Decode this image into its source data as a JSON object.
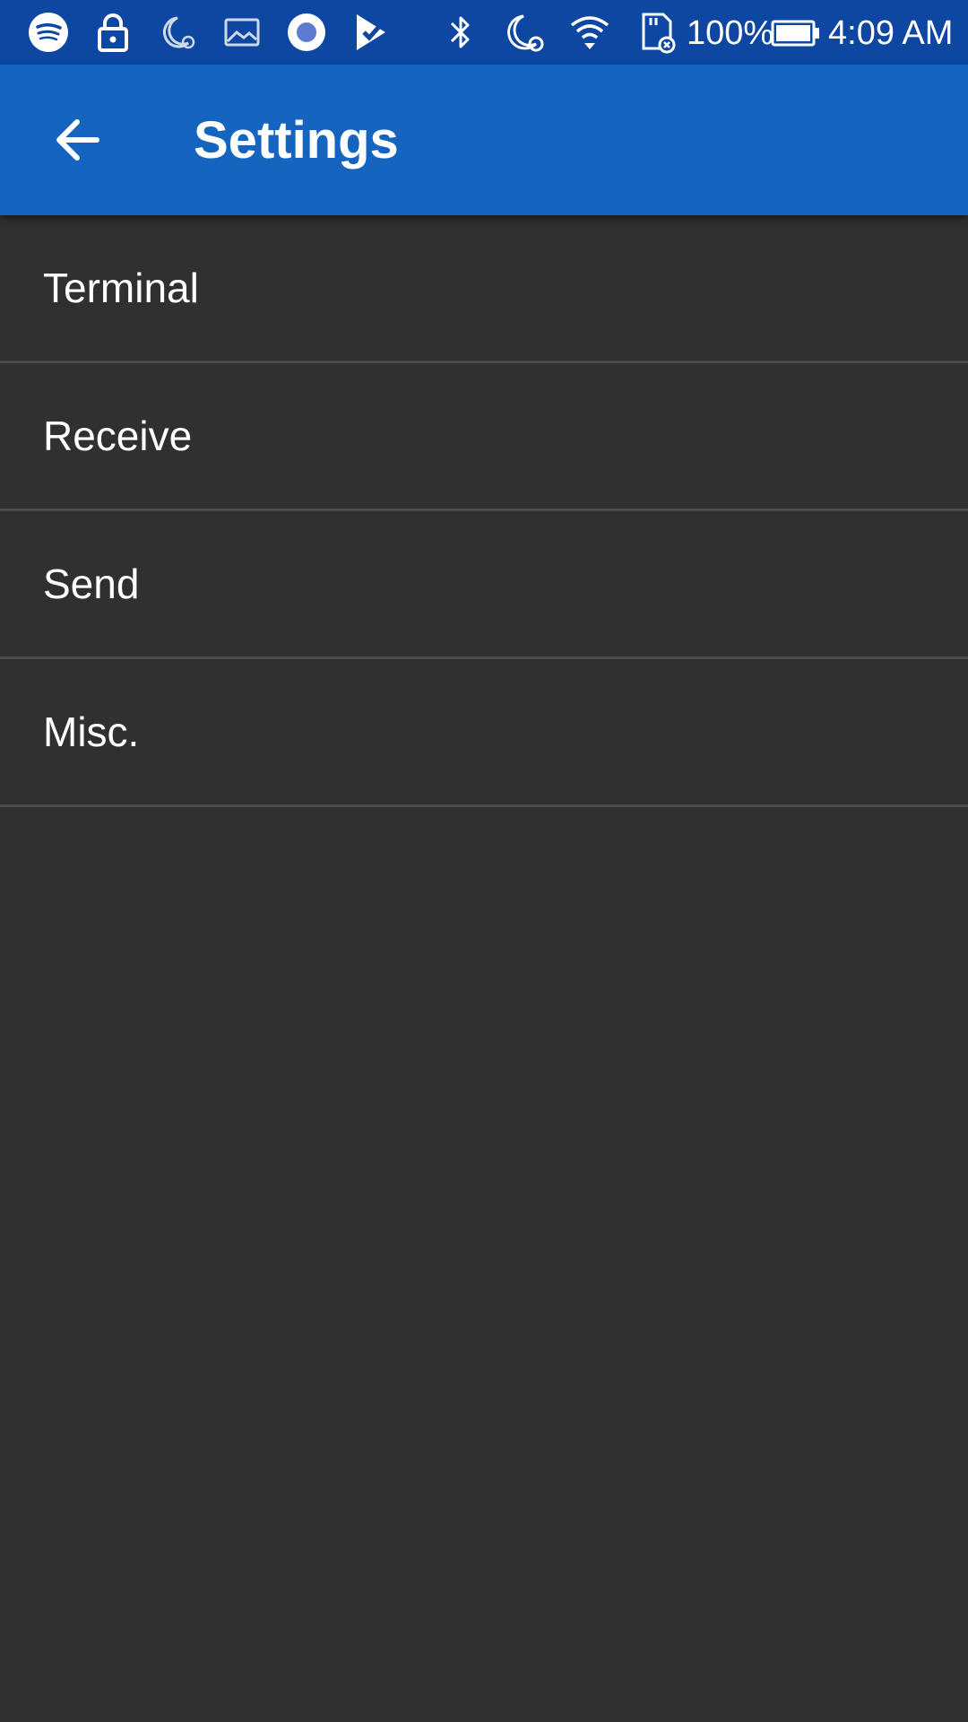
{
  "status_bar": {
    "notification_icons": [
      "spotify-icon",
      "lock-icon",
      "night-alarm-icon",
      "image-icon",
      "record-icon",
      "check-app-icon"
    ],
    "system_icons": [
      "bluetooth-icon",
      "night-alarm-icon",
      "wifi-icon",
      "sd-card-icon"
    ],
    "battery_text": "100%",
    "time": "4:09 AM",
    "background_color": "#0D47A1"
  },
  "app_bar": {
    "back_icon": "arrow-back-icon",
    "title": "Settings",
    "background_color": "#1565C0"
  },
  "settings": {
    "items": [
      {
        "label": "Terminal"
      },
      {
        "label": "Receive"
      },
      {
        "label": "Send"
      },
      {
        "label": "Misc."
      }
    ]
  },
  "theme": {
    "background": "#303030",
    "divider": "#4a4a4a",
    "text": "#ffffff"
  }
}
